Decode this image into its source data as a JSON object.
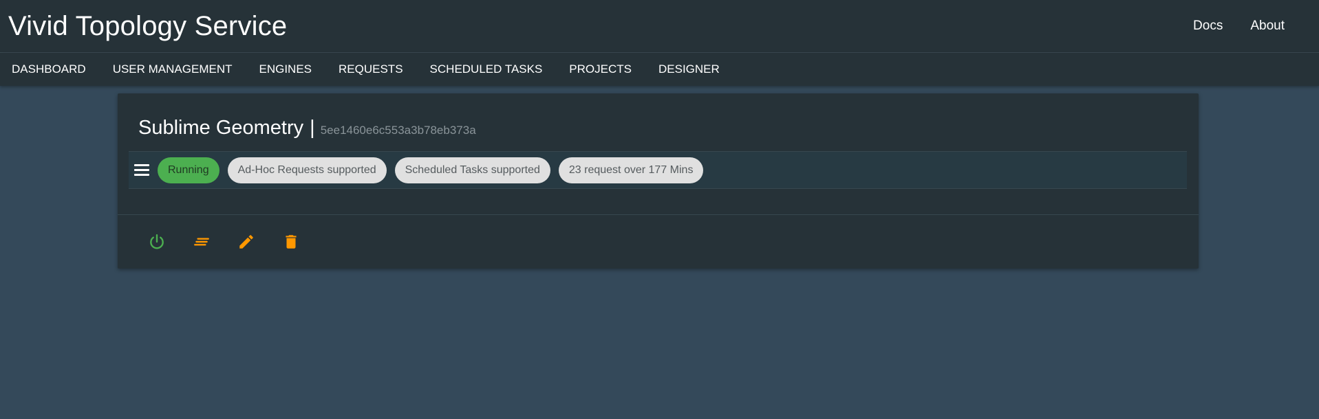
{
  "app": {
    "title": "Vivid Topology Service"
  },
  "top_links": [
    {
      "label": "Docs"
    },
    {
      "label": "About"
    }
  ],
  "nav": {
    "items": [
      {
        "label": "DASHBOARD"
      },
      {
        "label": "USER MANAGEMENT"
      },
      {
        "label": "ENGINES"
      },
      {
        "label": "REQUESTS"
      },
      {
        "label": "SCHEDULED TASKS"
      },
      {
        "label": "PROJECTS"
      },
      {
        "label": "DESIGNER"
      }
    ]
  },
  "engine": {
    "name": "Sublime Geometry",
    "separator": "|",
    "id": "5ee1460e6c553a3b78eb373a",
    "chips": [
      {
        "label": "Running",
        "status": "running"
      },
      {
        "label": "Ad-Hoc Requests supported"
      },
      {
        "label": "Scheduled Tasks supported"
      },
      {
        "label": "23 request over 177 Mins"
      }
    ],
    "actions": [
      {
        "icon": "power-icon",
        "color": "#4caf50"
      },
      {
        "icon": "logs-icon",
        "color": "#ff9800"
      },
      {
        "icon": "edit-icon",
        "color": "#ff9800"
      },
      {
        "icon": "delete-icon",
        "color": "#ff9800"
      }
    ]
  },
  "colors": {
    "background": "#34495a",
    "header": "#263238",
    "running": "#4caf50",
    "accent": "#ff9800"
  }
}
